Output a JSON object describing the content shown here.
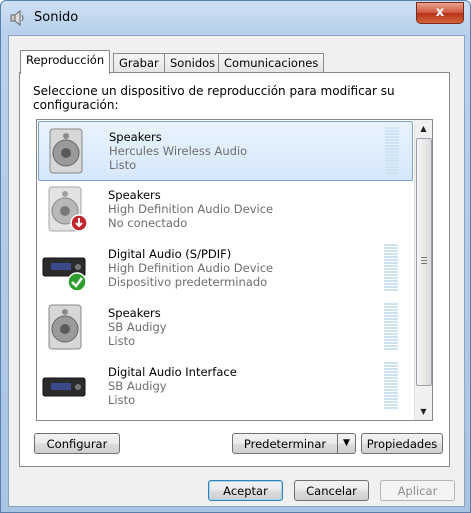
{
  "window": {
    "title": "Sonido",
    "close_label": "x"
  },
  "tabs": [
    {
      "label": "Reproducción",
      "active": true
    },
    {
      "label": "Grabar",
      "active": false
    },
    {
      "label": "Sonidos",
      "active": false
    },
    {
      "label": "Comunicaciones",
      "active": false
    }
  ],
  "instructions": "Seleccione un dispositivo de reproducción para modificar su configuración:",
  "devices": [
    {
      "name": "Speakers",
      "description": "Hercules Wireless Audio",
      "status": "Listo",
      "icon": "speaker-icon",
      "selected": true
    },
    {
      "name": "Speakers",
      "description": "High Definition Audio Device",
      "status": "No conectado",
      "icon": "speaker-disconnected-icon",
      "selected": false
    },
    {
      "name": "Digital Audio (S/PDIF)",
      "description": "High Definition Audio Device",
      "status": "Dispositivo predeterminado",
      "icon": "digital-audio-default-icon",
      "selected": false
    },
    {
      "name": "Speakers",
      "description": "SB Audigy",
      "status": "Listo",
      "icon": "speaker-icon",
      "selected": false
    },
    {
      "name": "Digital Audio Interface",
      "description": "SB Audigy",
      "status": "Listo",
      "icon": "digital-audio-icon",
      "selected": false
    }
  ],
  "buttons": {
    "configure": "Configurar",
    "set_default": "Predeterminar",
    "properties": "Propiedades",
    "ok": "Aceptar",
    "cancel": "Cancelar",
    "apply": "Aplicar"
  },
  "colors": {
    "accent": "#3c7fb1",
    "selection": "#d5e8fb",
    "default_check": "#2f9e2f",
    "disconnected": "#c0262b"
  }
}
